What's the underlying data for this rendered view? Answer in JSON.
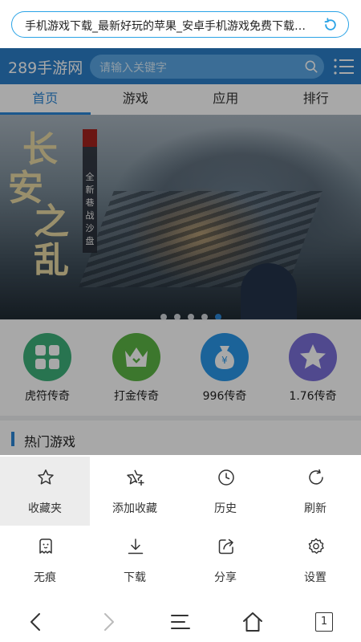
{
  "address_bar": {
    "url_title": "手机游戏下载_最新好玩的苹果_安卓手机游戏免费下载网..."
  },
  "site": {
    "logo": "289手游网",
    "search_placeholder": "请输入关键字",
    "nav_tabs": [
      {
        "label": "首页",
        "active": true
      },
      {
        "label": "游戏",
        "active": false
      },
      {
        "label": "应用",
        "active": false
      },
      {
        "label": "排行",
        "active": false
      }
    ],
    "banner": {
      "title_chars": [
        "长",
        "安",
        "之乱"
      ],
      "stamp": "乱之",
      "subtitle": "全新巷战沙盘",
      "dots": 5,
      "active_dot": 4
    },
    "game_icons": [
      {
        "label": "虎符传奇",
        "color": "#3db07a",
        "icon": "grid-icon"
      },
      {
        "label": "打金传奇",
        "color": "#5cb545",
        "icon": "crown-icon"
      },
      {
        "label": "996传奇",
        "color": "#2a97e8",
        "icon": "money-bag-icon"
      },
      {
        "label": "1.76传奇",
        "color": "#7a6fd8",
        "icon": "star-icon"
      }
    ],
    "section_title": "热门游戏"
  },
  "menu": {
    "items": [
      {
        "label": "收藏夹",
        "icon": "star-outline-icon"
      },
      {
        "label": "添加收藏",
        "icon": "star-plus-icon"
      },
      {
        "label": "历史",
        "icon": "clock-icon"
      },
      {
        "label": "刷新",
        "icon": "refresh-icon"
      },
      {
        "label": "无痕",
        "icon": "ghost-icon"
      },
      {
        "label": "下载",
        "icon": "download-icon"
      },
      {
        "label": "分享",
        "icon": "share-icon"
      },
      {
        "label": "设置",
        "icon": "gear-icon"
      }
    ]
  },
  "bottom_bar": {
    "tab_count": "1"
  },
  "colors": {
    "accent": "#2b86d6",
    "header": "#2b7fc8",
    "address_border": "#2aa3e6"
  }
}
